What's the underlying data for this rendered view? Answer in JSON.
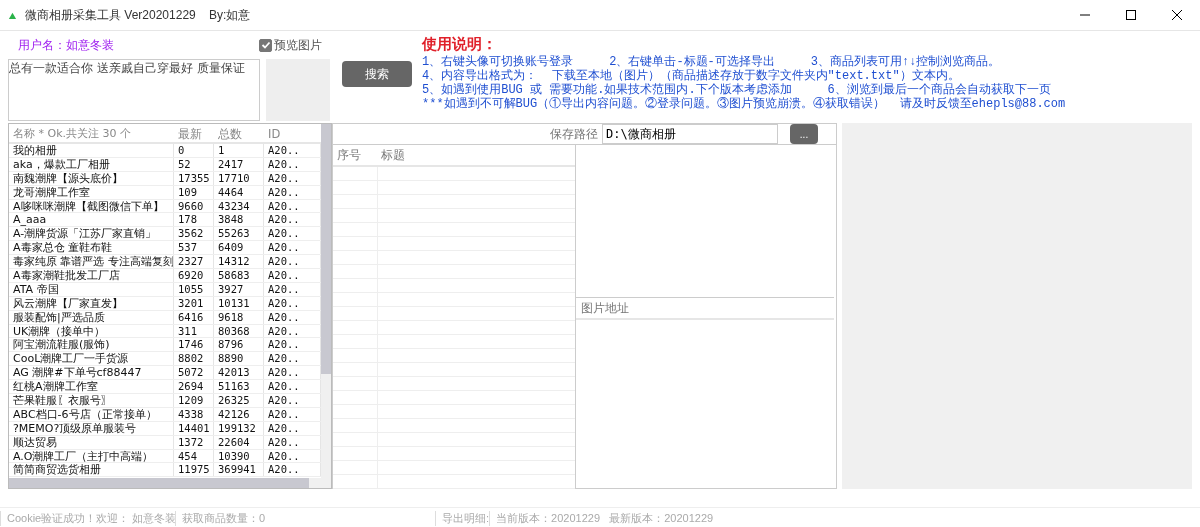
{
  "window": {
    "title": "微商相册采集工具 Ver20201229    By:如意"
  },
  "user": {
    "label": "用户名：如意冬装"
  },
  "preview_checkbox": {
    "label": "预览图片",
    "checked": true
  },
  "description": {
    "value": "总有一款适合你 送亲戚自己穿最好 质量保证"
  },
  "search_button": {
    "label": "搜索"
  },
  "instructions": {
    "heading": "使用说明：",
    "lines": [
      "1、右键头像可切换账号登录     2、右键单击-标题-可选择导出     3、商品列表可用↑↓控制浏览商品。",
      "4、内容导出格式为：  下载至本地（图片）（商品描述存放于数字文件夹内\"text.txt\"）文本内。",
      "5、如遇到使用BUG 或 需要功能.如果技术范围内.下个版本考虑添加     6、浏览到最后一个商品会自动获取下一页",
      "***如遇到不可解BUG（①导出内容问题。②登录问题。③图片预览崩溃。④获取错误）  请及时反馈至ehepls@88.com"
    ]
  },
  "accounts": {
    "columns": [
      "名称 * Ok.共关注 30 个",
      "最新",
      "总数",
      "ID"
    ],
    "rows": [
      [
        "我的相册",
        "0",
        "1",
        "A20.."
      ],
      [
        "aka，爆款工厂相册",
        "52",
        "2417",
        "A20.."
      ],
      [
        "南魏潮牌【源头底价】",
        "17355",
        "17710",
        "A20.."
      ],
      [
        "龙哥潮牌工作室",
        "109",
        "4464",
        "A20.."
      ],
      [
        "A哆咪咪潮牌【截图微信下单】",
        "9660",
        "43234",
        "A20.."
      ],
      [
        "A_aaa",
        "178",
        "3848",
        "A20.."
      ],
      [
        "A-潮牌货源「江苏厂家直销」",
        "3562",
        "55263",
        "A20.."
      ],
      [
        "A毒家总仓 童鞋布鞋",
        "537",
        "6409",
        "A20.."
      ],
      [
        "毒家纯原 靠谱严选 专注高端复刻",
        "2327",
        "14312",
        "A20.."
      ],
      [
        "A毒家潮鞋批发工厂店",
        "6920",
        "58683",
        "A20.."
      ],
      [
        "ATA 帝国",
        "1055",
        "3927",
        "A20.."
      ],
      [
        "风云潮牌【厂家直发】",
        "3201",
        "10131",
        "A20.."
      ],
      [
        "服装配饰|严选品质",
        "6416",
        "9618",
        "A20.."
      ],
      [
        "UK潮牌（接单中）",
        "311",
        "80368",
        "A20.."
      ],
      [
        "阿宝潮流鞋服(服饰)",
        "1746",
        "8796",
        "A20.."
      ],
      [
        "CooL潮牌工厂一手货源",
        "8802",
        "8890",
        "A20.."
      ],
      [
        "AG 潮牌#下单号cf88447",
        "5072",
        "42013",
        "A20.."
      ],
      [
        "红桃A潮牌工作室",
        "2694",
        "51163",
        "A20.."
      ],
      [
        "芒果鞋服〖衣服号〗",
        "1209",
        "26325",
        "A20.."
      ],
      [
        "ABC档口-6号店（正常接单）",
        "4338",
        "42126",
        "A20.."
      ],
      [
        "?MEMO?顶级原单服装号",
        "14401",
        "199132",
        "A20.."
      ],
      [
        "顺达贸易",
        "1372",
        "22604",
        "A20.."
      ],
      [
        "A.O潮牌工厂（主打中高端）",
        "454",
        "10390",
        "A20.."
      ],
      [
        "简简商贸选货相册",
        "11975",
        "369941",
        "A20.."
      ]
    ]
  },
  "save_path": {
    "label": "保存路径",
    "value": "D:\\微商相册",
    "browse_button": "..."
  },
  "products": {
    "columns": [
      "序号",
      "标题"
    ]
  },
  "image_urls": {
    "header": "图片地址"
  },
  "status_bar": [
    "Cookie验证成功！欢迎： 如意冬装",
    "获取商品数量：0",
    "导出明细:",
    "当前版本：20201229   最新版本：20201229"
  ]
}
